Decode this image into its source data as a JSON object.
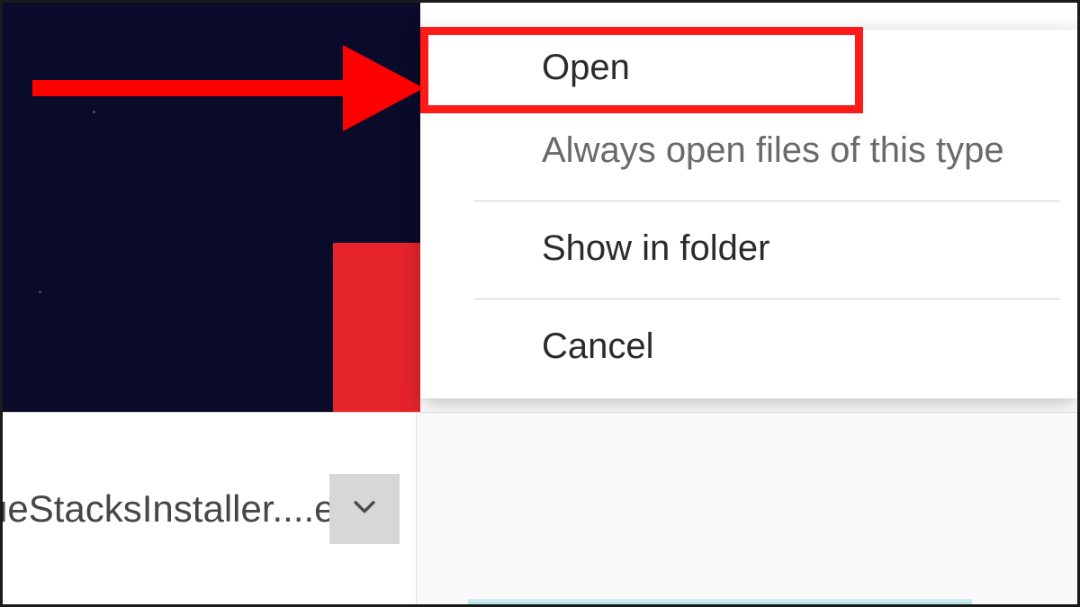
{
  "menu": {
    "open": "Open",
    "always_open": "Always open files of this type",
    "show_in_folder": "Show in folder",
    "cancel": "Cancel"
  },
  "download": {
    "filename": "ueStacksInstaller....exe"
  },
  "annotation": {
    "highlight_color": "#ff1a1a"
  }
}
